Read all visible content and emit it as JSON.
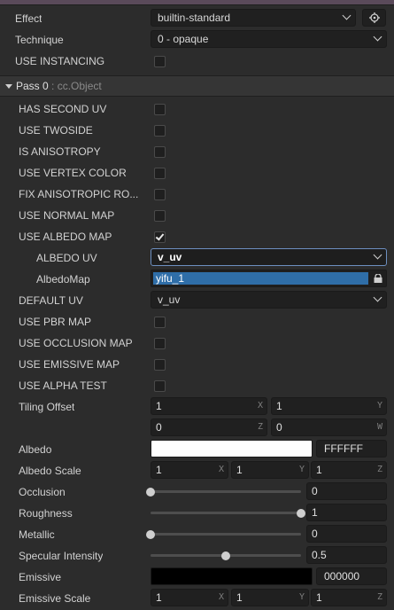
{
  "effect": {
    "label": "Effect",
    "value": "builtin-standard",
    "locate_icon": "locate-target-icon"
  },
  "technique": {
    "label": "Technique",
    "value": "0 - opaque"
  },
  "use_instancing": {
    "label": "USE INSTANCING",
    "checked": false
  },
  "pass": {
    "title": "Pass 0",
    "type": ": cc.Object"
  },
  "defines": [
    {
      "label": "HAS SECOND UV",
      "checked": false
    },
    {
      "label": "USE TWOSIDE",
      "checked": false
    },
    {
      "label": "IS ANISOTROPY",
      "checked": false
    },
    {
      "label": "USE VERTEX COLOR",
      "checked": false
    },
    {
      "label": "FIX ANISOTROPIC RO...",
      "checked": false
    },
    {
      "label": "USE NORMAL MAP",
      "checked": false
    },
    {
      "label": "USE ALBEDO MAP",
      "checked": true
    }
  ],
  "albedo_uv": {
    "label": "ALBEDO UV",
    "value": "v_uv"
  },
  "albedo_map": {
    "label": "AlbedoMap",
    "value": "yifu_1",
    "lock_icon": "lock-icon"
  },
  "default_uv": {
    "label": "DEFAULT UV",
    "value": "v_uv"
  },
  "defines2": [
    {
      "label": "USE PBR MAP",
      "checked": false
    },
    {
      "label": "USE OCCLUSION MAP",
      "checked": false
    },
    {
      "label": "USE EMISSIVE MAP",
      "checked": false
    },
    {
      "label": "USE ALPHA TEST",
      "checked": false
    }
  ],
  "tiling_offset": {
    "label": "Tiling Offset",
    "x": "1",
    "y": "1",
    "z": "0",
    "w": "0",
    "axis_x": "X",
    "axis_y": "Y",
    "axis_z": "Z",
    "axis_w": "W"
  },
  "albedo": {
    "label": "Albedo",
    "color": "#ffffff",
    "hex": "FFFFFF"
  },
  "albedo_scale": {
    "label": "Albedo Scale",
    "x": "1",
    "y": "1",
    "z": "1",
    "axis_x": "X",
    "axis_y": "Y",
    "axis_z": "Z"
  },
  "occlusion": {
    "label": "Occlusion",
    "value": "0",
    "fraction": 0
  },
  "roughness": {
    "label": "Roughness",
    "value": "1",
    "fraction": 1
  },
  "metallic": {
    "label": "Metallic",
    "value": "0",
    "fraction": 0
  },
  "specular": {
    "label": "Specular Intensity",
    "value": "0.5",
    "fraction": 0.5
  },
  "emissive": {
    "label": "Emissive",
    "color": "#000000",
    "hex": "000000"
  },
  "emissive_scale": {
    "label": "Emissive Scale",
    "x": "1",
    "y": "1",
    "z": "1",
    "axis_x": "X",
    "axis_y": "Y",
    "axis_z": "Z"
  },
  "colors": {
    "accent": "#2f6ea8",
    "focus_border": "#6d8fc0",
    "background": "#2c2c2c"
  }
}
